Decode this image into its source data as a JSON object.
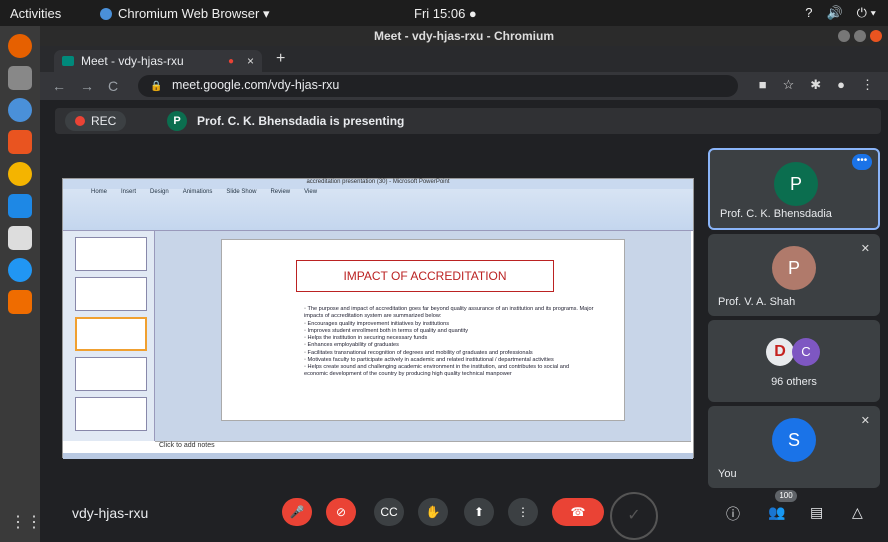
{
  "os": {
    "activities": "Activities",
    "app_name": "Chromium Web Browser ▾",
    "clock": "Fri 15:06 ●",
    "tray": [
      "?",
      "🔊",
      "⏻ ▾"
    ]
  },
  "window": {
    "title": "Meet - vdy-hjas-rxu - Chromium"
  },
  "browser": {
    "tab_title": "Meet - vdy-hjas-rxu",
    "tab_recording": "●",
    "tab_close": "×",
    "new_tab": "+",
    "url": "meet.google.com/vdy-hjas-rxu"
  },
  "meet": {
    "rec_label": "REC",
    "presenter_initial": "P",
    "presenting_text": "Prof. C. K. Bhensdadia is presenting",
    "meeting_code": "vdy-hjas-rxu",
    "participant_count": "100",
    "participants": [
      {
        "initial": "P",
        "name": "Prof. C. K. Bhensdadia",
        "color": "#0b6e4f"
      },
      {
        "initial": "P",
        "name": "Prof. V. A. Shah",
        "color": "#b07a6b"
      },
      {
        "initial": "C",
        "name": "96 others",
        "color": "#7e57c2"
      },
      {
        "initial": "S",
        "name": "You",
        "color": "#1a73e8"
      }
    ]
  },
  "presentation": {
    "window_title": "accreditation presentation (30) - Microsoft PowerPoint",
    "ribbon_tabs": [
      "Home",
      "Insert",
      "Design",
      "Animations",
      "Slide Show",
      "Review",
      "View"
    ],
    "slide_title": "IMPACT OF ACCREDITATION",
    "bullets": [
      "The purpose and impact of accreditation goes far beyond quality assurance of an institution and its programs. Major impacts of accreditation system are summarized below:",
      "Encourages quality improvement initiatives by institutions",
      "Improves student enrollment both in terms of quality and quantity",
      "Helps the institution in securing necessary funds",
      "Enhances employability of graduates",
      "Facilitates transnational recognition of degrees and mobility of graduates and professionals",
      "Motivates faculty to participate actively in academic and related institutional / departmental activities",
      "Helps create sound and challenging academic environment in the institution, and contributes to social and economic development of the country by producing high quality technical manpower"
    ],
    "notes_placeholder": "Click to add notes"
  }
}
